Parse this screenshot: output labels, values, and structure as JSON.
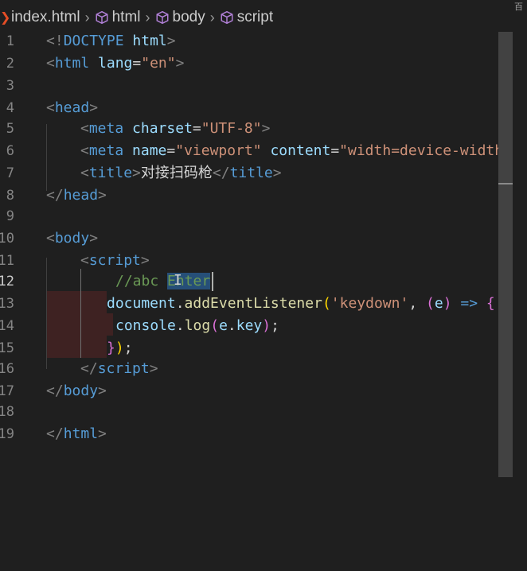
{
  "breadcrumb": {
    "file": "index.html",
    "items": [
      "html",
      "body",
      "script"
    ],
    "corner_text": "百"
  },
  "editor": {
    "line_numbers": [
      "1",
      "2",
      "3",
      "4",
      "5",
      "6",
      "7",
      "8",
      "9",
      "10",
      "11",
      "12",
      "13",
      "14",
      "15",
      "16",
      "17",
      "18",
      "19"
    ],
    "active_line": "12",
    "lines": {
      "l1": {
        "b1": "<!",
        "tag": "DOCTYPE",
        "sp": " ",
        "attr": "html",
        "b2": ">"
      },
      "l2": {
        "b1": "<",
        "tag": "html",
        "sp": " ",
        "attr": "lang",
        "eq": "=",
        "str": "\"en\"",
        "b2": ">"
      },
      "l4": {
        "b1": "<",
        "tag": "head",
        "b2": ">"
      },
      "l5": {
        "b1": "<",
        "tag": "meta",
        "sp": " ",
        "attr": "charset",
        "eq": "=",
        "str": "\"UTF-8\"",
        "b2": ">"
      },
      "l6": {
        "b1": "<",
        "tag": "meta",
        "sp": " ",
        "attr": "name",
        "eq": "=",
        "str": "\"viewport\"",
        "sp2": " ",
        "attr2": "content",
        "eq2": "=",
        "str2": "\"width=device-width"
      },
      "l7": {
        "b1": "<",
        "tag": "title",
        "b2": ">",
        "txt": "对接扫码枪",
        "b3": "</",
        "tag2": "title",
        "b4": ">"
      },
      "l8": {
        "b1": "</",
        "tag": "head",
        "b2": ">"
      },
      "l10": {
        "b1": "<",
        "tag": "body",
        "b2": ">"
      },
      "l11": {
        "b1": "<",
        "tag": "script",
        "b2": ">"
      },
      "l12": {
        "cmt": "//abc ",
        "sel": "Enter"
      },
      "l13": {
        "v": "document",
        "dot": ".",
        "fn": "addEventListener",
        "p1": "(",
        "str": "'keydown'",
        "c": ", ",
        "p2": "(",
        "arg": "e",
        "p2c": ")",
        "arrow": " => ",
        "p3": "{"
      },
      "l14": {
        "v": "console",
        "dot": ".",
        "fn": "log",
        "p1": "(",
        "v2": "e",
        "dot2": ".",
        "v3": "key",
        "p1c": ")",
        "semi": ";"
      },
      "l15": {
        "p3": "}",
        "p1c": ")",
        "semi": ";"
      },
      "l16": {
        "b1": "</",
        "tag": "script",
        "b2": ">"
      },
      "l17": {
        "b1": "</",
        "tag": "body",
        "b2": ">"
      },
      "l19": {
        "b1": "</",
        "tag": "html",
        "b2": ">"
      }
    }
  },
  "colors": {
    "background": "#1f1f1f",
    "tag": "#569cd6",
    "attribute": "#9cdcfe",
    "string": "#ce9178",
    "comment": "#6a9955",
    "function": "#dcdcaa",
    "selection": "#264f78"
  }
}
